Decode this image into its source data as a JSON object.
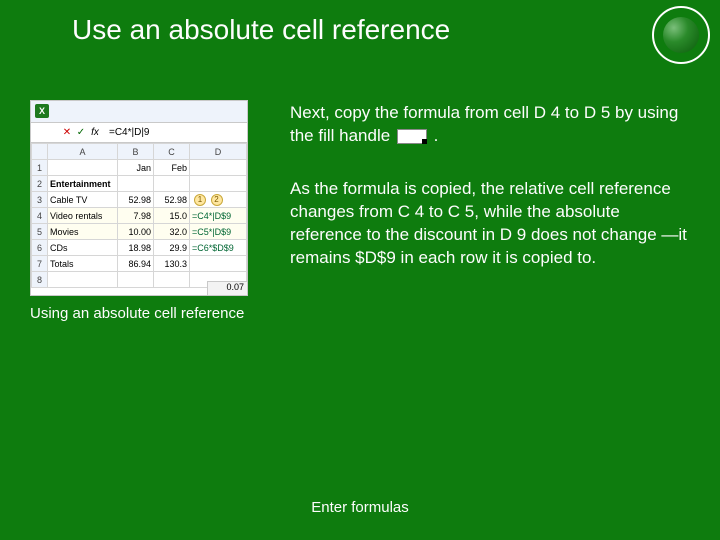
{
  "title": "Use an absolute cell reference",
  "logo_name": "institute-seal",
  "excel": {
    "icon_letter": "X",
    "fx_x": "✕",
    "fx_check": "✓",
    "fx_label": "fx",
    "formula": "=C4*|D|9",
    "col_headers": [
      "",
      "A",
      "B",
      "C",
      "D"
    ],
    "rows": [
      {
        "n": "1",
        "a": "",
        "b": "Jan",
        "c": "Feb",
        "d": ""
      },
      {
        "n": "2",
        "a": "Entertainment",
        "b": "",
        "c": "",
        "d": ""
      },
      {
        "n": "3",
        "a": "Cable TV",
        "b": "52.98",
        "c": "52.98",
        "d": "",
        "callouts": [
          "1",
          "2"
        ]
      },
      {
        "n": "4",
        "a": "Video rentals",
        "b": "7.98",
        "c": "15.0",
        "d": "=C4*|D$9"
      },
      {
        "n": "5",
        "a": "Movies",
        "b": "10.00",
        "c": "32.0",
        "d": "=C5*|D$9"
      },
      {
        "n": "6",
        "a": "CDs",
        "b": "18.98",
        "c": "29.9",
        "d": "=C6*$D$9"
      },
      {
        "n": "7",
        "a": "Totals",
        "b": "86.94",
        "c": "130.3",
        "d": ""
      },
      {
        "n": "8",
        "a": "",
        "b": "",
        "c": "",
        "d": ""
      }
    ],
    "bottom_value": "0.07"
  },
  "caption": "Using an absolute cell reference",
  "para1_a": "Next, copy the formula from cell D 4 to D 5 by using the fill handle ",
  "para1_b": ".",
  "para2": "As the formula is copied, the relative cell reference changes from C 4 to C 5, while the absolute reference to the discount in D 9 does not change —it remains $D$9 in each row it is copied to.",
  "footer": "Enter formulas"
}
